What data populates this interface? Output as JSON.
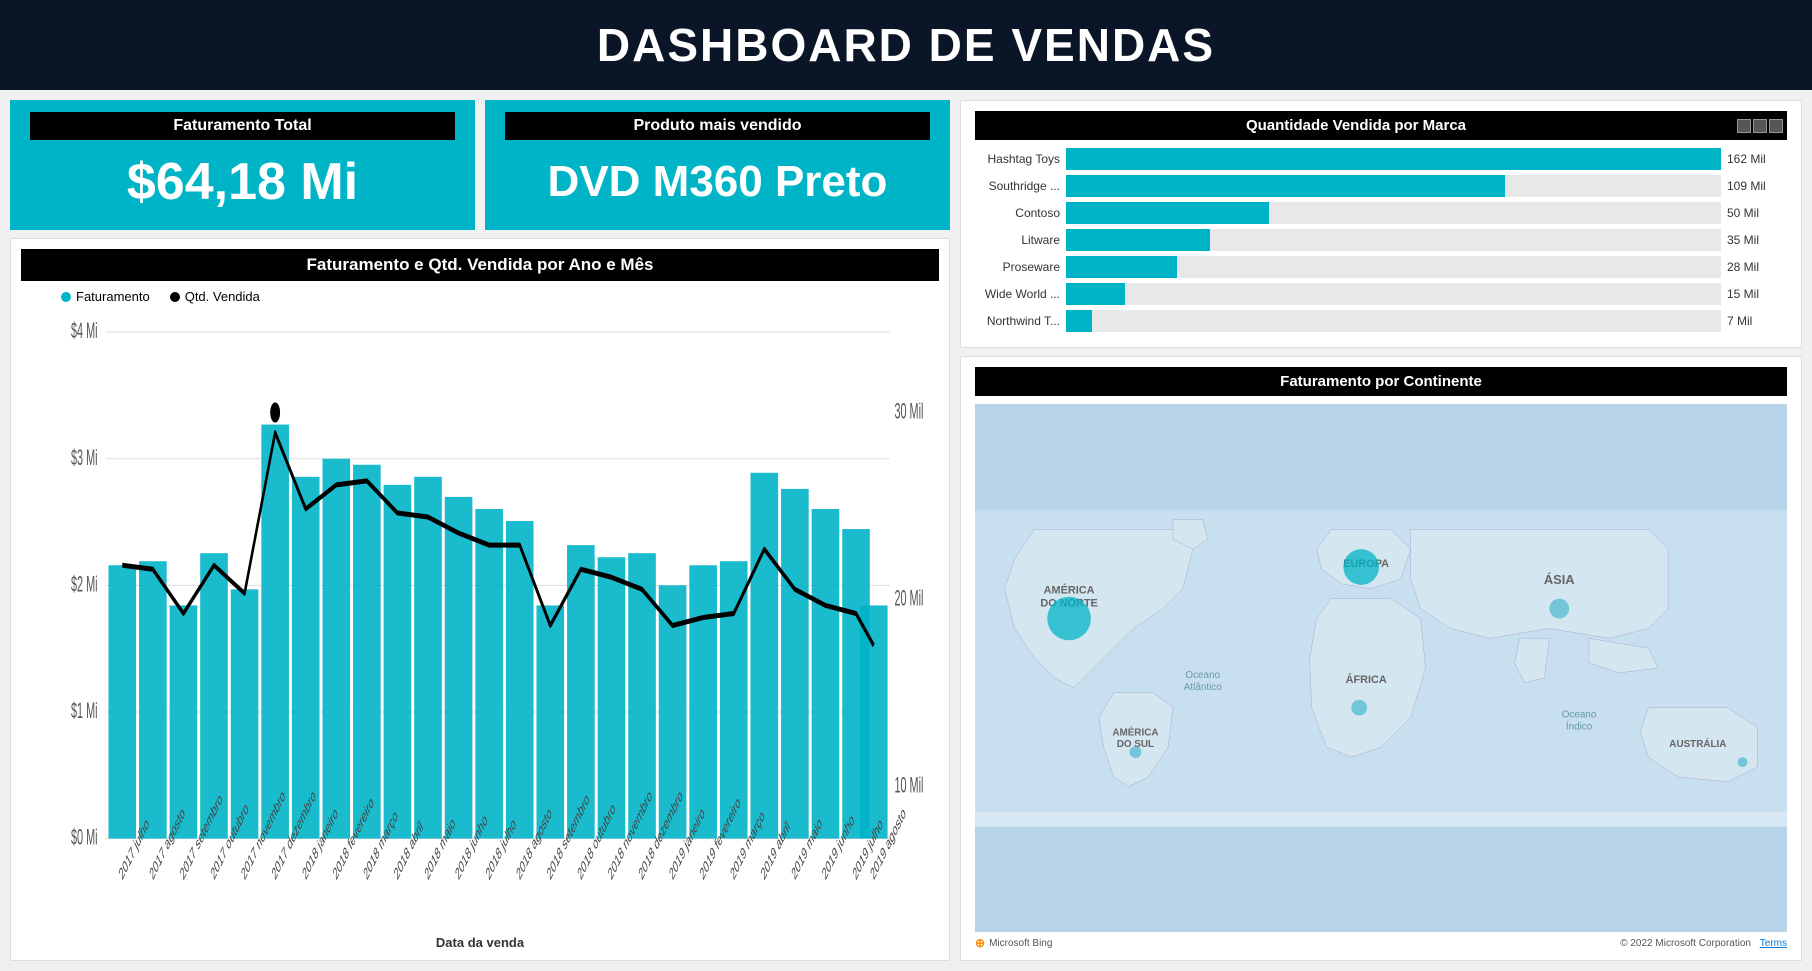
{
  "header": {
    "title": "DASHBOARD DE VENDAS"
  },
  "kpis": {
    "faturamento": {
      "title": "Faturamento Total",
      "value": "$64,18 Mi"
    },
    "produto": {
      "title": "Produto mais vendido",
      "value": "DVD M360 Preto"
    }
  },
  "chart": {
    "title": "Faturamento e Qtd. Vendida por Ano e Mês",
    "legend_faturamento": "Faturamento",
    "legend_qtd": "Qtd. Vendida",
    "x_label": "Data da venda",
    "y_left_labels": [
      "$4 Mi",
      "$3 Mi",
      "$2 Mi",
      "$1 Mi",
      "$0 Mi"
    ],
    "y_right_labels": [
      "30 Mil",
      "20 Mil",
      "10 Mil"
    ],
    "x_labels": [
      "2017 julho",
      "2017 agosto",
      "2017 setembro",
      "2017 outubro",
      "2017 novembro",
      "2017 dezembro",
      "2018 janeiro",
      "2018 fevereiro",
      "2018 março",
      "2018 abril",
      "2018 maio",
      "2018 junho",
      "2018 julho",
      "2018 agosto",
      "2018 setembro",
      "2018 outubro",
      "2018 novembro",
      "2018 dezembro",
      "2019 janeiro",
      "2019 fevereiro",
      "2019 março",
      "2019 abril",
      "2019 maio",
      "2019 junho",
      "2019 julho",
      "2019 agosto"
    ]
  },
  "brands": {
    "title": "Quantidade Vendida por Marca",
    "items": [
      {
        "name": "Hashtag Toys",
        "value": "162 Mil",
        "pct": 100
      },
      {
        "name": "Southridge ...",
        "value": "109 Mil",
        "pct": 67
      },
      {
        "name": "Contoso",
        "value": "50 Mil",
        "pct": 31
      },
      {
        "name": "Litware",
        "value": "35 Mil",
        "pct": 22
      },
      {
        "name": "Proseware",
        "value": "28 Mil",
        "pct": 17
      },
      {
        "name": "Wide World ...",
        "value": "15 Mil",
        "pct": 9
      },
      {
        "name": "Northwind T...",
        "value": "7 Mil",
        "pct": 4
      }
    ]
  },
  "map": {
    "title": "Faturamento por Continente",
    "labels": [
      "AMÉRICA DO NORTE",
      "EUROPA",
      "ÁSIA",
      "ÁFRICA",
      "AMÉRICA DO SUL",
      "AUSTRÁLIA"
    ],
    "ocean_labels": [
      "Oceano Atlântico",
      "Oceano Índico"
    ],
    "footer_copyright": "© 2022 Microsoft Corporation",
    "footer_terms": "Terms",
    "footer_bing": "Microsoft Bing"
  }
}
